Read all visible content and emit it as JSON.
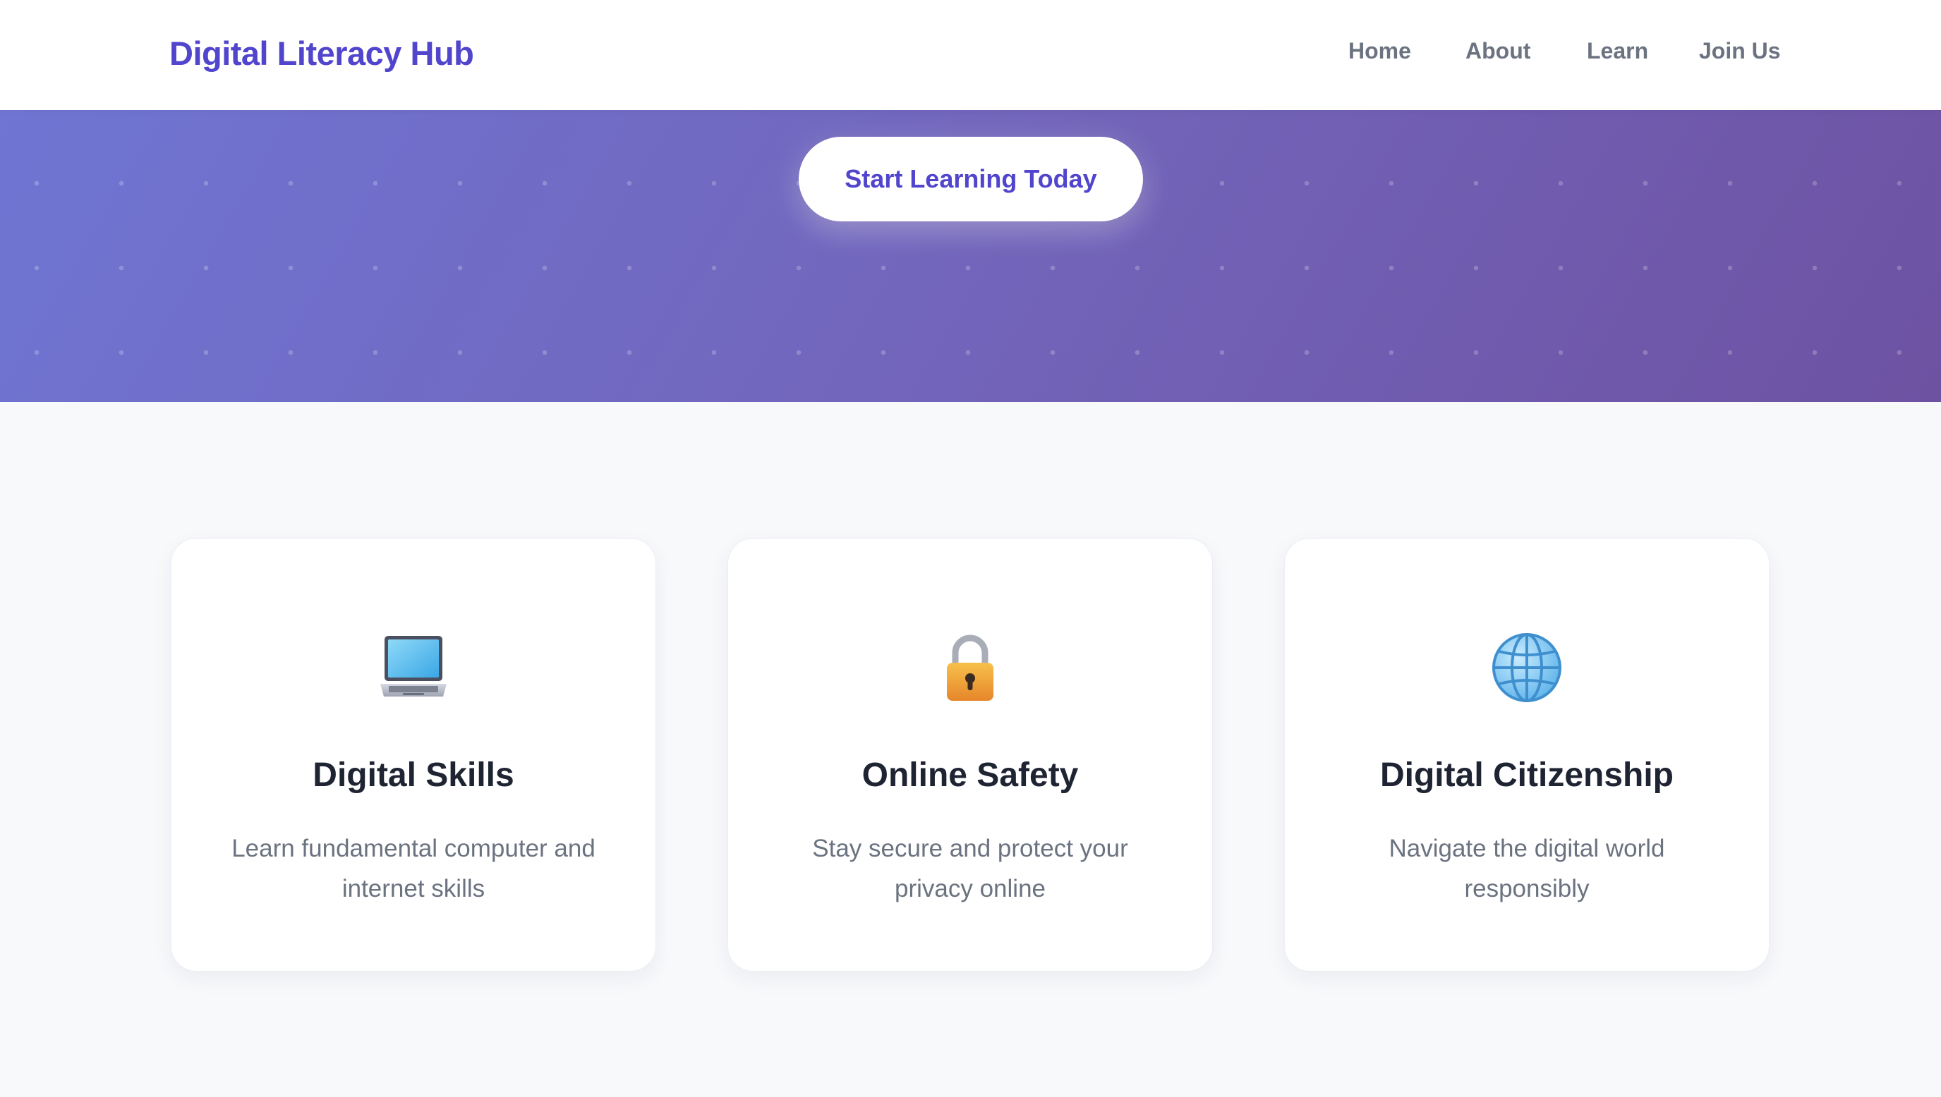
{
  "header": {
    "logo": "Digital Literacy Hub",
    "nav": [
      {
        "label": "Home"
      },
      {
        "label": "About"
      },
      {
        "label": "Learn"
      },
      {
        "label": "Join Us"
      }
    ]
  },
  "hero": {
    "cta_label": "Start Learning Today"
  },
  "features": [
    {
      "icon": "laptop-icon",
      "title": "Digital Skills",
      "text": "Learn fundamental computer and internet skills"
    },
    {
      "icon": "lock-icon",
      "title": "Online Safety",
      "text": "Stay secure and protect your privacy online"
    },
    {
      "icon": "globe-icon",
      "title": "Digital Citizenship",
      "text": "Navigate the digital world responsibly"
    }
  ],
  "colors": {
    "brand": "#5145cd",
    "hero_start": "#6f75d3",
    "hero_end": "#6e52a2",
    "text_dark": "#1f2433",
    "text_muted": "#6b7280",
    "page_bg": "#f8f9fb"
  }
}
